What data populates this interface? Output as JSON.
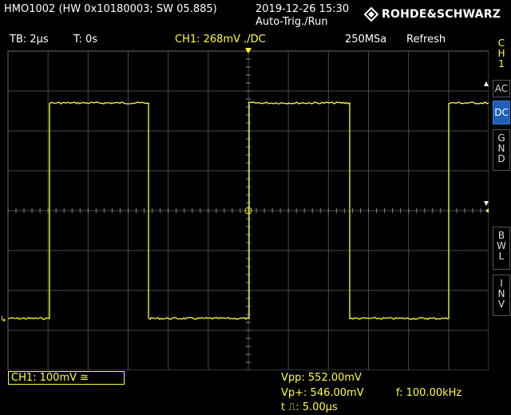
{
  "header": {
    "device_info": "HMO1002 (HW 0x10180003; SW 05.885)",
    "timestamp": "2019-12-26 15:30",
    "trigger_mode": "Auto-Trig./Run",
    "brand": "ROHDE&SCHWARZ"
  },
  "status": {
    "timebase": "TB: 2µs",
    "trigger_time": "T: 0s",
    "ch1_status": "CH1: 268mV ./DC",
    "sample_rate": "250MSa",
    "acq_mode": "Refresh"
  },
  "side_panel": {
    "channel": [
      "C",
      "H",
      "1"
    ],
    "buttons": [
      {
        "id": "ac",
        "label": [
          "AC"
        ],
        "active": false
      },
      {
        "id": "dc",
        "label": [
          "DC"
        ],
        "active": true
      },
      {
        "id": "gnd",
        "label": [
          "G",
          "N",
          "D"
        ],
        "active": false
      },
      {
        "id": "bwl",
        "label": [
          "B",
          "W",
          "L"
        ],
        "active": false
      },
      {
        "id": "inv",
        "label": [
          "I",
          "N",
          "V"
        ],
        "active": false
      }
    ]
  },
  "bottom": {
    "ch1_scale": "CH1: 100mV ≅",
    "vpp": "Vpp: 552.00mV",
    "vp_plus": "Vp+: 546.00mV",
    "frequency": "f: 100.00kHz",
    "pulse_width": "t ⎍: 5.00µs"
  },
  "chart_data": {
    "type": "line",
    "series": [
      {
        "period_us": 10,
        "duty": 0.5,
        "high_div": 2.7,
        "low_div": -2.7,
        "first_rise_us": -10
      }
    ],
    "xlim_div": [
      -6,
      6
    ],
    "ylim_div": [
      -4,
      4
    ],
    "x_per_div_us": 2,
    "grid": true,
    "colors": {
      "trace": "#ffff33",
      "grid": "#4a4a4a",
      "ch1": "#ffff33"
    }
  }
}
